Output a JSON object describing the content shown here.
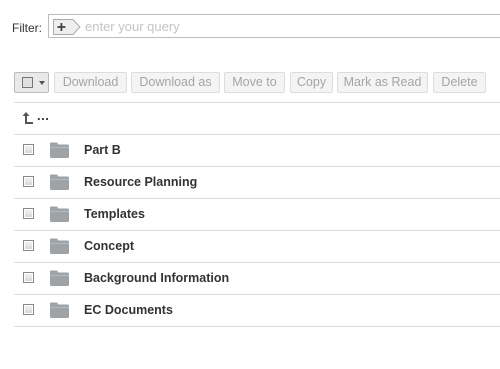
{
  "filter": {
    "label": "Filter:",
    "placeholder": "enter your query",
    "value": "",
    "add_icon": "plus-tag-icon"
  },
  "toolbar": {
    "select_icon": "checkbox-dropdown-icon",
    "download_label": "Download",
    "download_as_label": "Download as",
    "move_to_label": "Move to",
    "copy_label": "Copy",
    "mark_as_read_label": "Mark as Read",
    "delete_label": "Delete"
  },
  "list": {
    "parent_label": "...",
    "parent_icon": "arrow-up-icon",
    "folder_icon": "folder-icon",
    "items": [
      {
        "name": "Part B"
      },
      {
        "name": "Resource Planning"
      },
      {
        "name": "Templates"
      },
      {
        "name": "Concept"
      },
      {
        "name": "Background Information"
      },
      {
        "name": "EC Documents"
      }
    ]
  },
  "colors": {
    "folder": "#9ea3a8",
    "border": "#dcdcdc",
    "disabled_text": "#a5a5a5"
  }
}
